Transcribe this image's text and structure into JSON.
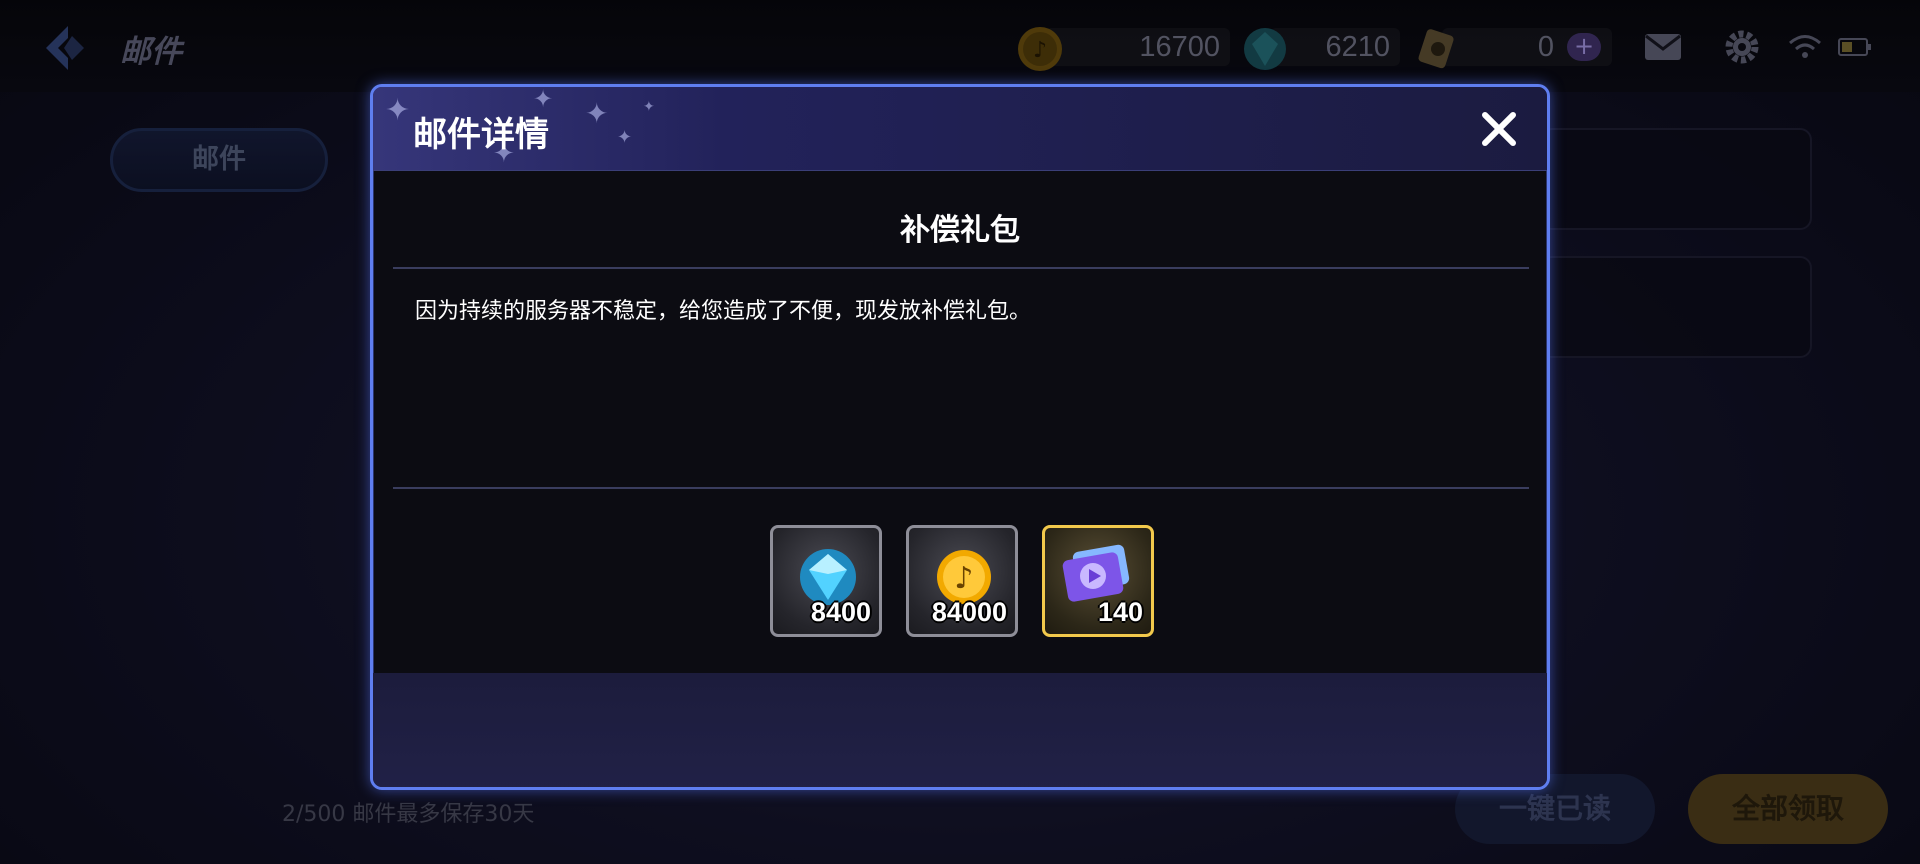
{
  "header": {
    "title": "邮件",
    "currencies": [
      {
        "icon": "music-coin-icon",
        "value": "16700"
      },
      {
        "icon": "gem-icon",
        "value": "6210"
      },
      {
        "icon": "ticket-icon",
        "value": "0"
      }
    ],
    "plus_label": "+"
  },
  "sidebar": {
    "tab_label": "邮件"
  },
  "footer": {
    "note": "2/500 邮件最多保存30天",
    "read_all_label": "一键已读",
    "claim_all_label": "全部领取"
  },
  "modal": {
    "title": "邮件详情",
    "subject": "补偿礼包",
    "body": "因为持续的服务器不稳定，给您造成了不便，现发放补偿礼包。",
    "rewards": [
      {
        "icon": "gem-icon",
        "quantity": "8400",
        "frame_color": "#8e8e98"
      },
      {
        "icon": "music-coin-icon",
        "quantity": "84000",
        "frame_color": "#8e8e98"
      },
      {
        "icon": "play-ticket-icon",
        "quantity": "140",
        "frame_color": "#f2c94c"
      }
    ]
  },
  "colors": {
    "accent": "#5f7ef0",
    "gold": "#f2c94c"
  }
}
